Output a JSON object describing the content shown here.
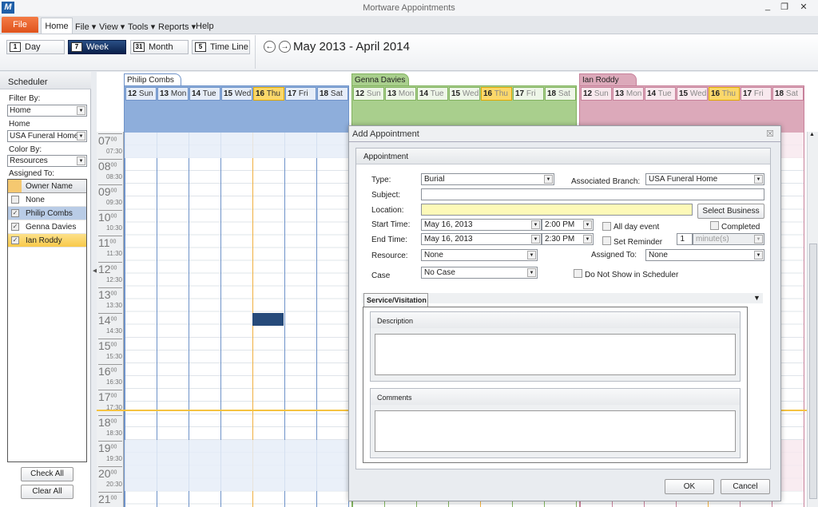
{
  "window": {
    "logo": "M",
    "title": "Mortware Appointments",
    "minimize": "_",
    "restore": "❐",
    "close": "✕"
  },
  "ribbon": {
    "file_label": "File",
    "home_tab": "Home",
    "menus": [
      "File ▾",
      "View ▾",
      "Tools ▾",
      "Reports ▾",
      "Help"
    ],
    "views": [
      {
        "label": "Day",
        "icon": "1"
      },
      {
        "label": "Week",
        "icon": "7",
        "active": true
      },
      {
        "label": "Month",
        "icon": "31"
      },
      {
        "label": "Time Line",
        "icon": "5"
      }
    ],
    "prev": "←",
    "next": "→",
    "date_range": "May 2013 - April 2014"
  },
  "sidebar": {
    "title": "Scheduler",
    "filter_by_label": "Filter By:",
    "filter_by": "Home",
    "home_label": "Home",
    "home": "USA Funeral Home",
    "color_by_label": "Color By:",
    "color_by": "Resources",
    "assigned_label": "Assigned To:",
    "grid_header": "Owner Name",
    "owners": [
      {
        "name": "None",
        "checked": false
      },
      {
        "name": "Philip Combs",
        "checked": true,
        "selected": true
      },
      {
        "name": "Genna Davies",
        "checked": true
      },
      {
        "name": "Ian Roddy",
        "checked": true,
        "highlight": true
      }
    ],
    "check_all": "Check All",
    "clear_all": "Clear All"
  },
  "scheduler": {
    "days": [
      {
        "num": "12",
        "name": "Sun"
      },
      {
        "num": "13",
        "name": "Mon"
      },
      {
        "num": "14",
        "name": "Tue"
      },
      {
        "num": "15",
        "name": "Wed"
      },
      {
        "num": "16",
        "name": "Thu",
        "today": true
      },
      {
        "num": "17",
        "name": "Fri"
      },
      {
        "num": "18",
        "name": "Sat"
      }
    ],
    "resources": [
      {
        "name": "Philip Combs",
        "color": "#8eaedb",
        "light": "#e6edf8",
        "border": "#6f93c9"
      },
      {
        "name": "Genna Davies",
        "color": "#a9cf8d",
        "light": "#eef6e8",
        "border": "#82b35f"
      },
      {
        "name": "Ian Roddy",
        "color": "#dca9ba",
        "light": "#f8e9ee",
        "border": "#c7809a"
      }
    ],
    "hours": [
      "07",
      "08",
      "09",
      "10",
      "11",
      "12",
      "13",
      "14",
      "15",
      "16",
      "17",
      "18",
      "19",
      "20",
      "21"
    ],
    "minutes": "00",
    "half": "30",
    "appointment": {
      "resource": "Philip Combs",
      "day": "16",
      "start": "14:00",
      "end": "14:30",
      "color": "#264a7a"
    },
    "current_time": "17:50"
  },
  "dialog": {
    "title": "Add Appointment",
    "close": "☒",
    "group": "Appointment",
    "type_label": "Type:",
    "type": "Burial",
    "branch_label": "Associated Branch:",
    "branch": "USA Funeral Home",
    "subject_label": "Subject:",
    "subject": "",
    "location_label": "Location:",
    "location": "",
    "select_business": "Select Business",
    "start_label": "Start Time:",
    "start_date": "May  16, 2013",
    "start_time": "2:00  PM",
    "all_day": "All day event",
    "completed": "Completed",
    "end_label": "End Time:",
    "end_date": "May  16, 2013",
    "end_time": "2:30  PM",
    "set_reminder": "Set Reminder",
    "reminder_value": "1",
    "reminder_unit": "minute(s)",
    "resource_label": "Resource:",
    "resource": "None",
    "assigned_label": "Assigned To:",
    "assigned": "None",
    "case_label": "Case",
    "case": "No Case",
    "do_not_show": "Do Not Show in Scheduler",
    "tab": "Service/Visitation",
    "description_label": "Description",
    "comments_label": "Comments",
    "ok": "OK",
    "cancel": "Cancel"
  }
}
